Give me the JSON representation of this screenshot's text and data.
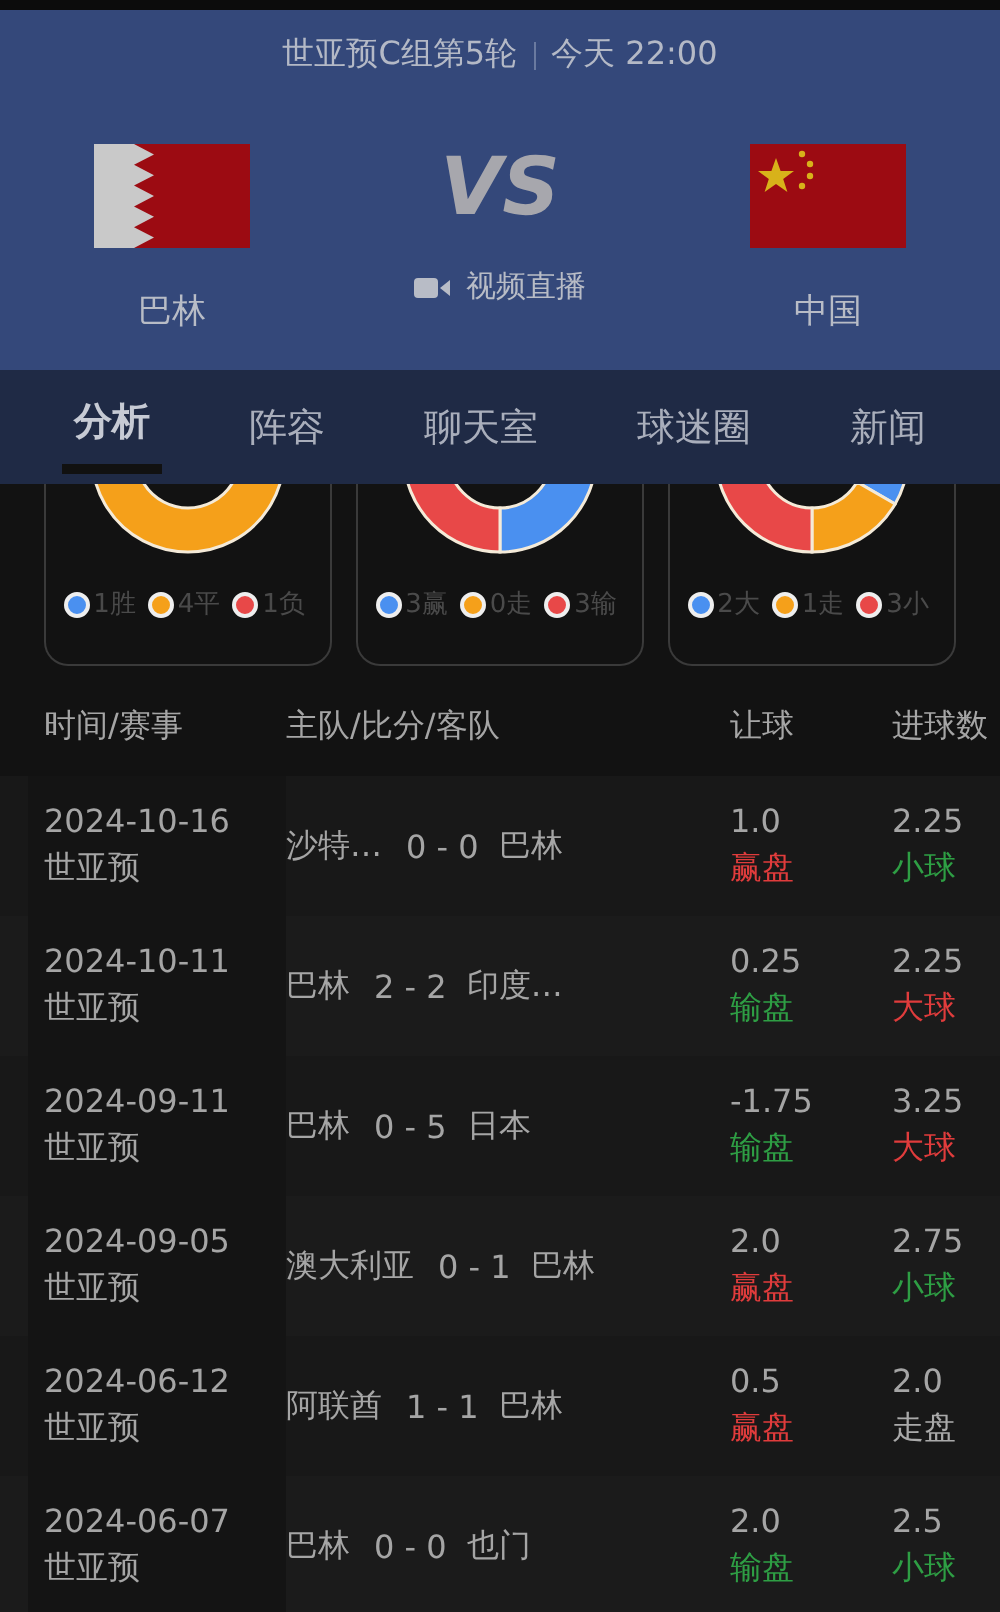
{
  "header": {
    "round": "世亚预C组第5轮",
    "time": "今天 22:00",
    "vs": "VS",
    "home": {
      "name": "巴林"
    },
    "away": {
      "name": "中国"
    },
    "live": "视频直播"
  },
  "tabs": [
    {
      "label": "分析",
      "selected": true
    },
    {
      "label": "阵容",
      "selected": false
    },
    {
      "label": "聊天室",
      "selected": false
    },
    {
      "label": "球迷圈",
      "selected": false
    },
    {
      "label": "新闻",
      "selected": false
    }
  ],
  "summaries": [
    {
      "legend": [
        {
          "label": "1胜",
          "color": "#4a90f0"
        },
        {
          "label": "4平",
          "color": "#f5a01a"
        },
        {
          "label": "1负",
          "color": "#e84848"
        }
      ]
    },
    {
      "legend": [
        {
          "label": "3赢",
          "color": "#4a90f0"
        },
        {
          "label": "0走",
          "color": "#f5a01a"
        },
        {
          "label": "3输",
          "color": "#e84848"
        }
      ]
    },
    {
      "legend": [
        {
          "label": "2大",
          "color": "#4a90f0"
        },
        {
          "label": "1走",
          "color": "#f5a01a"
        },
        {
          "label": "3小",
          "color": "#e84848"
        }
      ]
    }
  ],
  "table": {
    "columns": [
      "时间/赛事",
      "主队/比分/客队",
      "让球",
      "进球数"
    ],
    "rows": [
      {
        "date": "2024-10-16",
        "event": "世亚预",
        "home": "沙特…",
        "score": "0 - 0",
        "away": "巴林",
        "handicap": "1.0",
        "handicap_result": {
          "text": "赢盘",
          "kind": "win"
        },
        "goals": "2.25",
        "goals_result": {
          "text": "小球",
          "kind": "under"
        }
      },
      {
        "date": "2024-10-11",
        "event": "世亚预",
        "home": "巴林",
        "score": "2 - 2",
        "away": "印度…",
        "handicap": "0.25",
        "handicap_result": {
          "text": "输盘",
          "kind": "loss"
        },
        "goals": "2.25",
        "goals_result": {
          "text": "大球",
          "kind": "over"
        }
      },
      {
        "date": "2024-09-11",
        "event": "世亚预",
        "home": "巴林",
        "score": "0 - 5",
        "away": "日本",
        "handicap": "-1.75",
        "handicap_result": {
          "text": "输盘",
          "kind": "loss"
        },
        "goals": "3.25",
        "goals_result": {
          "text": "大球",
          "kind": "over"
        }
      },
      {
        "date": "2024-09-05",
        "event": "世亚预",
        "home": "澳大利亚",
        "score": "0 - 1",
        "away": "巴林",
        "handicap": "2.0",
        "handicap_result": {
          "text": "赢盘",
          "kind": "win"
        },
        "goals": "2.75",
        "goals_result": {
          "text": "小球",
          "kind": "under"
        }
      },
      {
        "date": "2024-06-12",
        "event": "世亚预",
        "home": "阿联酋",
        "score": "1 - 1",
        "away": "巴林",
        "handicap": "0.5",
        "handicap_result": {
          "text": "赢盘",
          "kind": "win"
        },
        "goals": "2.0",
        "goals_result": {
          "text": "走盘",
          "kind": "push"
        }
      },
      {
        "date": "2024-06-07",
        "event": "世亚预",
        "home": "巴林",
        "score": "0 - 0",
        "away": "也门",
        "handicap": "2.0",
        "handicap_result": {
          "text": "输盘",
          "kind": "loss"
        },
        "goals": "2.5",
        "goals_result": {
          "text": "小球",
          "kind": "under"
        }
      }
    ]
  }
}
